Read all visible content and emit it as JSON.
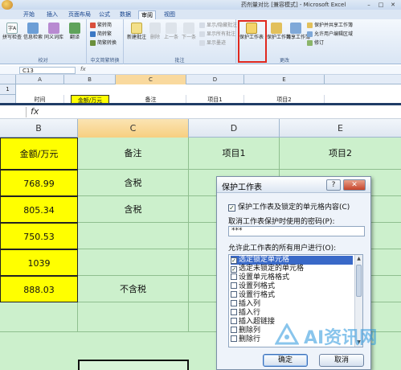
{
  "window": {
    "title": "药剂量对比 [兼容模式] - Microsoft Excel"
  },
  "ribbon_tabs": [
    "开始",
    "插入",
    "页面布局",
    "公式",
    "数据",
    "审阅",
    "视图"
  ],
  "ribbon": {
    "groups": {
      "proofing": {
        "label": "校对",
        "buttons": [
          "拼写检查",
          "信息检索",
          "同义词库",
          "翻译"
        ]
      },
      "chinese_conversion": {
        "label": "中文简繁转换",
        "items": [
          "繁转简",
          "简转繁",
          "简繁转换"
        ]
      },
      "comments": {
        "label": "批注",
        "buttons": [
          "新建批注",
          "删除",
          "上一条",
          "下一条"
        ],
        "items": [
          "显示/隐藏批注",
          "显示所有批注",
          "显示墨迹"
        ]
      },
      "changes": {
        "label": "更改",
        "protect_sheet": "保护工作表",
        "protect_workbook": "保护工作簿",
        "share_workbook": "共享工作簿",
        "items": [
          "保护并共享工作簿",
          "允许用户编辑区域",
          "修订"
        ]
      }
    }
  },
  "small_sheet": {
    "name_box": "C13",
    "fx": "fx",
    "columns": [
      "A",
      "B",
      "C",
      "D",
      "E"
    ],
    "selected_column": "C",
    "row_number": "1",
    "row_cells": [
      "时间",
      "金额/万元",
      "备注",
      "项目1",
      "项目2"
    ]
  },
  "sheet": {
    "fx": "fx",
    "columns": [
      "B",
      "C",
      "D",
      "E"
    ],
    "selected_column": "C",
    "header_row": [
      "金额/万元",
      "备注",
      "项目1",
      "项目2"
    ],
    "rows": [
      {
        "amount": "768.99",
        "note": "含税"
      },
      {
        "amount": "805.34",
        "note": "含税"
      },
      {
        "amount": "750.53",
        "note": ""
      },
      {
        "amount": "1039",
        "note": ""
      },
      {
        "amount": "888.03",
        "note": "不含税"
      }
    ]
  },
  "dialog": {
    "title": "保护工作表",
    "help": "?",
    "close": "✕",
    "protect_checkbox_label": "保护工作表及锁定的单元格内容(C)",
    "protect_checked": true,
    "password_label": "取消工作表保护时使用的密码(P):",
    "password_value": "***",
    "permissions_label": "允许此工作表的所有用户进行(O):",
    "permissions": [
      {
        "label": "选定锁定单元格",
        "checked": true,
        "selected": true
      },
      {
        "label": "选定未锁定的单元格",
        "checked": true,
        "selected": false
      },
      {
        "label": "设置单元格格式",
        "checked": false,
        "selected": false
      },
      {
        "label": "设置列格式",
        "checked": false,
        "selected": false
      },
      {
        "label": "设置行格式",
        "checked": false,
        "selected": false
      },
      {
        "label": "插入列",
        "checked": false,
        "selected": false
      },
      {
        "label": "插入行",
        "checked": false,
        "selected": false
      },
      {
        "label": "插入超链接",
        "checked": false,
        "selected": false
      },
      {
        "label": "删除列",
        "checked": false,
        "selected": false
      },
      {
        "label": "删除行",
        "checked": false,
        "selected": false
      }
    ],
    "ok": "确定",
    "cancel": "取消"
  },
  "watermark": {
    "text": "AI资讯网"
  },
  "colors": {
    "sheet_bg": "#ccf0cc",
    "yellow_cell": "#ffff00",
    "highlight_red": "#e0281e",
    "list_selection": "#3969c8"
  }
}
